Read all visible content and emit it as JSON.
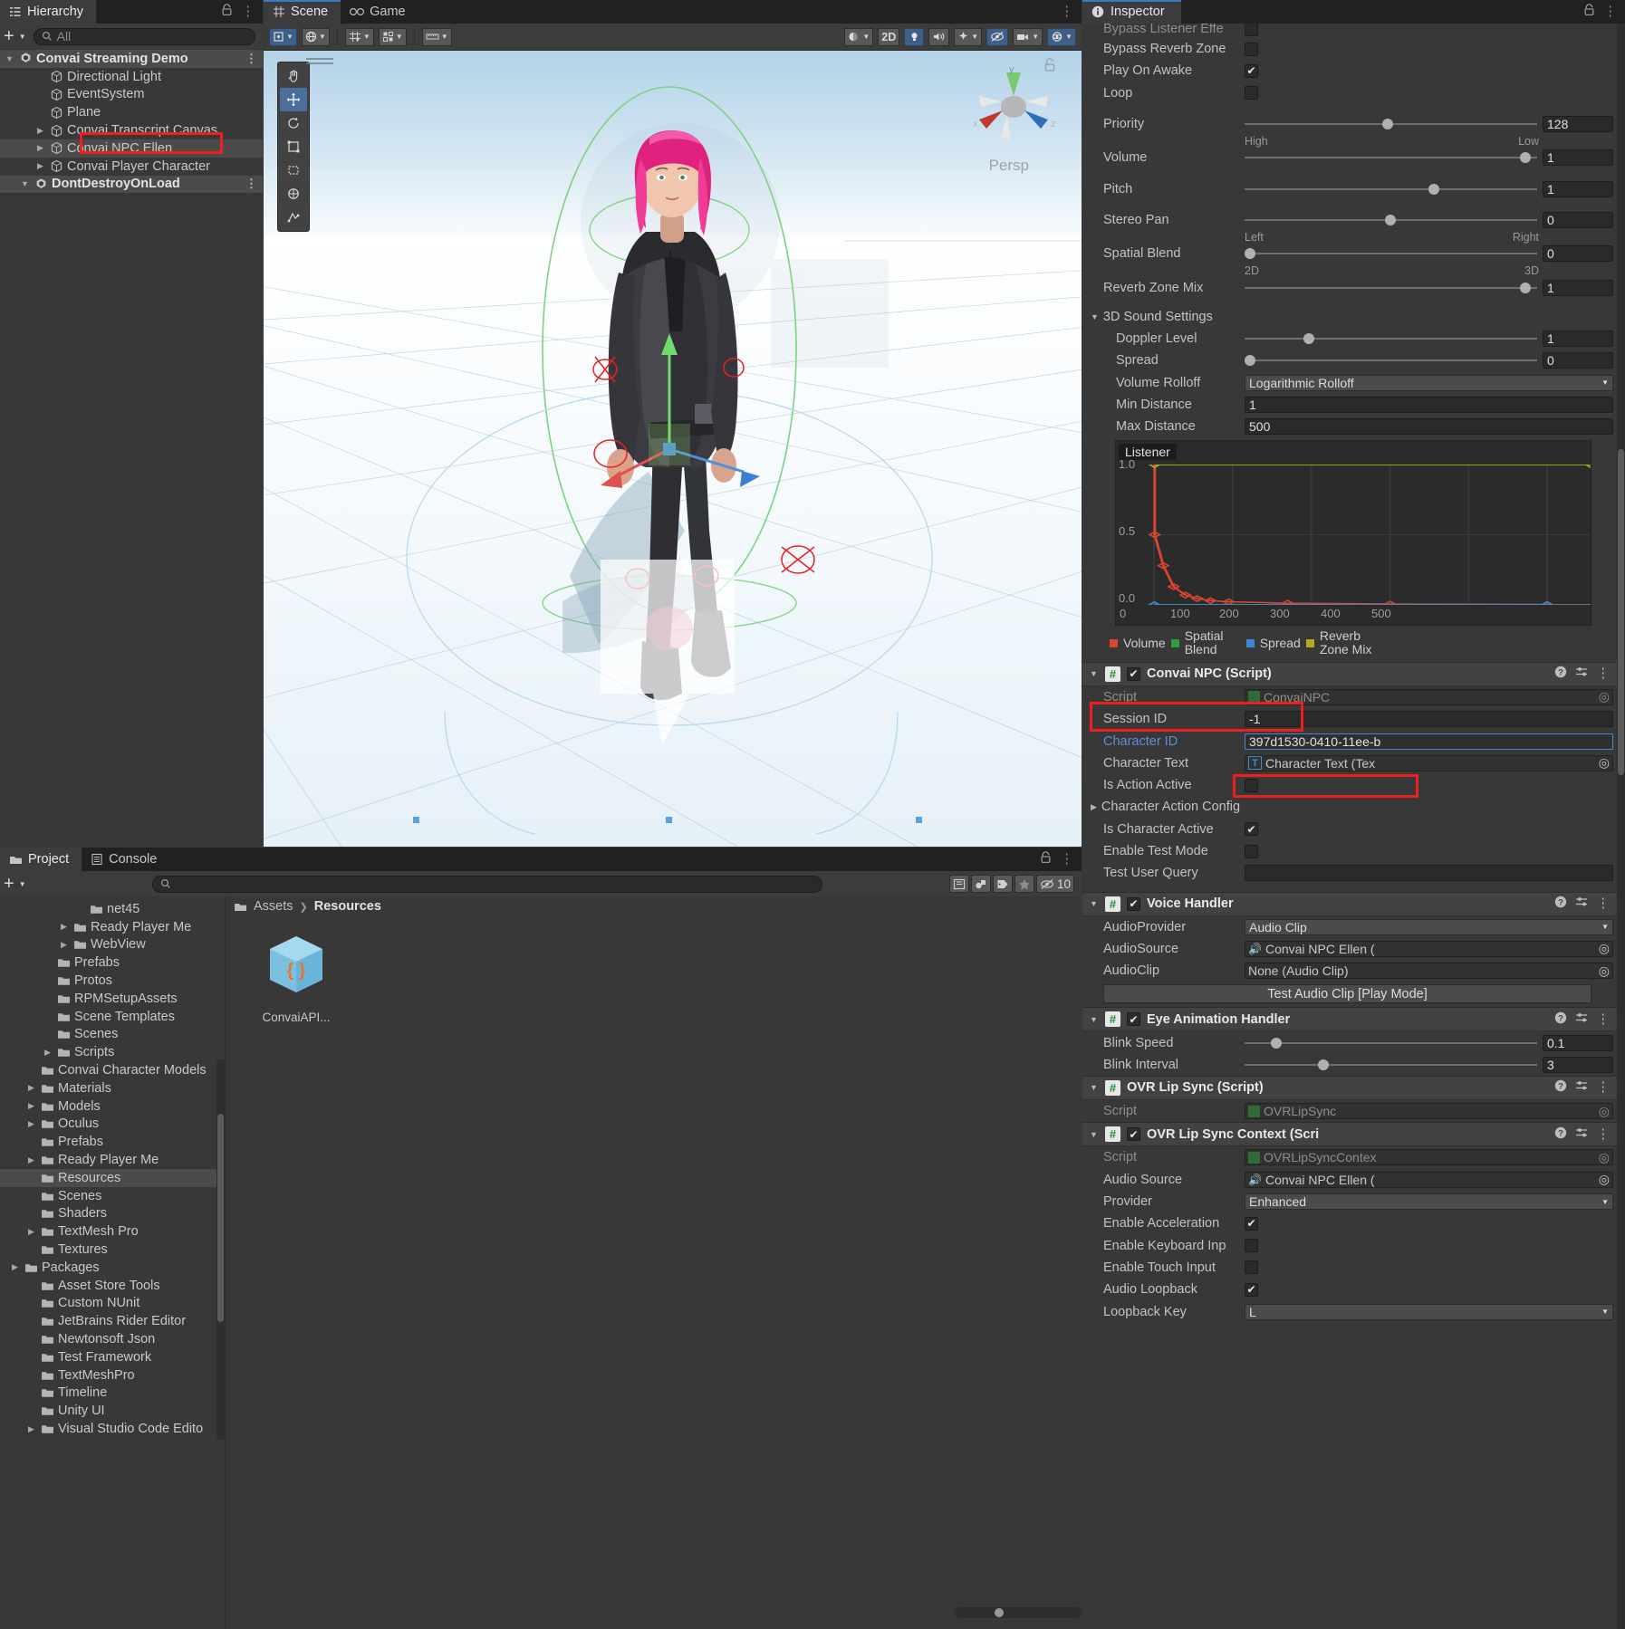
{
  "hierarchy": {
    "tab_label": "Hierarchy",
    "search_placeholder": "All",
    "add_label": "+",
    "items": [
      {
        "label": "Convai Streaming Demo",
        "icon": "unity-scene-icon",
        "kind": "scene",
        "expanded": true,
        "depth": 0
      },
      {
        "label": "Directional Light",
        "icon": "gameobject-cube-icon",
        "kind": "object",
        "expanded": null,
        "depth": 2
      },
      {
        "label": "EventSystem",
        "icon": "gameobject-cube-icon",
        "kind": "object",
        "expanded": null,
        "depth": 2
      },
      {
        "label": "Plane",
        "icon": "gameobject-cube-icon",
        "kind": "object",
        "expanded": null,
        "depth": 2
      },
      {
        "label": "Convai Transcript Canvas",
        "icon": "gameobject-cube-icon",
        "kind": "object",
        "expanded": false,
        "depth": 2
      },
      {
        "label": "Convai NPC Ellen",
        "icon": "gameobject-cube-icon",
        "kind": "object",
        "expanded": false,
        "depth": 2,
        "highlighted": true
      },
      {
        "label": "Convai Player Character",
        "icon": "gameobject-cube-icon",
        "kind": "object",
        "expanded": false,
        "depth": 2
      },
      {
        "label": "DontDestroyOnLoad",
        "icon": "unity-scene-icon",
        "kind": "scene",
        "expanded": true,
        "depth": 1
      }
    ]
  },
  "scene_view": {
    "tabs": [
      {
        "label": "Scene",
        "icon": "scene-grid-icon",
        "active": true
      },
      {
        "label": "Game",
        "icon": "game-pad-icon",
        "active": false
      }
    ],
    "projection_label": "Persp",
    "gizmo_axes": [
      "x",
      "y",
      "z"
    ],
    "toolbar": {
      "pivot_icon": "pivot-center-icon",
      "globe_icon": "global-space-icon",
      "grid_icon": "grid-snap-icon",
      "layers_icon": "component-toggle-icon",
      "audio_icon": "audio-ruler-icon",
      "shading_label": "shaded-mode-icon",
      "mode_2d_label": "2D",
      "light_icon": "light-toggle-icon",
      "audio_toggle_icon": "audio-toggle-icon",
      "fx_icon": "effects-icon",
      "hidden_icon": "hidden-objects-icon",
      "camera_icon": "scene-camera-icon",
      "gizmos_icon": "gizmos-icon"
    },
    "view_tools": [
      {
        "icon": "hand-tool-icon",
        "active": false
      },
      {
        "icon": "move-tool-icon",
        "active": true
      },
      {
        "icon": "rotate-tool-icon",
        "active": false
      },
      {
        "icon": "scale-tool-icon",
        "active": false
      },
      {
        "icon": "rect-tool-icon",
        "active": false
      },
      {
        "icon": "transform-tool-icon",
        "active": false
      },
      {
        "icon": "custom-tool-icon",
        "active": false
      }
    ]
  },
  "project": {
    "tabs": [
      {
        "label": "Project",
        "icon": "folder-icon",
        "active": true
      },
      {
        "label": "Console",
        "icon": "console-icon",
        "active": false
      }
    ],
    "search_placeholder": "",
    "toolbar_icons": [
      "save-search-icon",
      "asset-filter-icon",
      "label-filter-icon",
      "favorite-star-icon",
      "visibility-icon"
    ],
    "hidden_count": "10",
    "breadcrumb": [
      "Assets",
      "Resources"
    ],
    "tree": [
      {
        "label": "net45",
        "depth": 4,
        "expandable": false
      },
      {
        "label": "Ready Player Me",
        "depth": 3,
        "expandable": true
      },
      {
        "label": "WebView",
        "depth": 3,
        "expandable": true
      },
      {
        "label": "Prefabs",
        "depth": 2,
        "expandable": false
      },
      {
        "label": "Protos",
        "depth": 2,
        "expandable": false
      },
      {
        "label": "RPMSetupAssets",
        "depth": 2,
        "expandable": false
      },
      {
        "label": "Scene Templates",
        "depth": 2,
        "expandable": false
      },
      {
        "label": "Scenes",
        "depth": 2,
        "expandable": false
      },
      {
        "label": "Scripts",
        "depth": 2,
        "expandable": true
      },
      {
        "label": "Convai Character Models",
        "depth": 1,
        "expandable": false
      },
      {
        "label": "Materials",
        "depth": 1,
        "expandable": true
      },
      {
        "label": "Models",
        "depth": 1,
        "expandable": true
      },
      {
        "label": "Oculus",
        "depth": 1,
        "expandable": true
      },
      {
        "label": "Prefabs",
        "depth": 1,
        "expandable": false
      },
      {
        "label": "Ready Player Me",
        "depth": 1,
        "expandable": true
      },
      {
        "label": "Resources",
        "depth": 1,
        "expandable": false,
        "selected": true
      },
      {
        "label": "Scenes",
        "depth": 1,
        "expandable": false
      },
      {
        "label": "Shaders",
        "depth": 1,
        "expandable": false
      },
      {
        "label": "TextMesh Pro",
        "depth": 1,
        "expandable": true
      },
      {
        "label": "Textures",
        "depth": 1,
        "expandable": false
      },
      {
        "label": "Packages",
        "depth": 0,
        "expandable": true,
        "isroot": true
      },
      {
        "label": "Asset Store Tools",
        "depth": 1,
        "expandable": false
      },
      {
        "label": "Custom NUnit",
        "depth": 1,
        "expandable": false
      },
      {
        "label": "JetBrains Rider Editor",
        "depth": 1,
        "expandable": false
      },
      {
        "label": "Newtonsoft Json",
        "depth": 1,
        "expandable": false
      },
      {
        "label": "Test Framework",
        "depth": 1,
        "expandable": false
      },
      {
        "label": "TextMeshPro",
        "depth": 1,
        "expandable": false
      },
      {
        "label": "Timeline",
        "depth": 1,
        "expandable": false
      },
      {
        "label": "Unity UI",
        "depth": 1,
        "expandable": false
      },
      {
        "label": "Visual Studio Code Edito",
        "depth": 1,
        "expandable": true
      }
    ],
    "assets": [
      {
        "label": "ConvaiAPI...",
        "icon": "json-asset-icon"
      }
    ]
  },
  "inspector": {
    "tab_label": "Inspector",
    "audio_source": {
      "rows": [
        {
          "label": "Bypass Listener Effe",
          "type": "checkbox",
          "value": false,
          "clipped": true
        },
        {
          "label": "Bypass Reverb Zone",
          "type": "checkbox",
          "value": false
        },
        {
          "label": "Play On Awake",
          "type": "checkbox",
          "value": true
        },
        {
          "label": "Loop",
          "type": "checkbox",
          "value": false
        }
      ],
      "priority": {
        "label": "Priority",
        "value": "128",
        "knob_pct": 47,
        "left_label": "High",
        "right_label": "Low"
      },
      "volume": {
        "label": "Volume",
        "value": "1",
        "knob_pct": 94
      },
      "pitch": {
        "label": "Pitch",
        "value": "1",
        "knob_pct": 63
      },
      "stereo_pan": {
        "label": "Stereo Pan",
        "value": "0",
        "knob_pct": 48,
        "left_label": "Left",
        "right_label": "Right"
      },
      "spatial_blend": {
        "label": "Spatial Blend",
        "value": "0",
        "knob_pct": 2,
        "left_label": "2D",
        "right_label": "3D"
      },
      "reverb_zone_mix": {
        "label": "Reverb Zone Mix",
        "value": "1",
        "knob_pct": 94
      }
    },
    "sound3d": {
      "section_label": "3D Sound Settings",
      "doppler_level": {
        "label": "Doppler Level",
        "value": "1",
        "knob_pct": 20
      },
      "spread": {
        "label": "Spread",
        "value": "0",
        "knob_pct": 1
      },
      "volume_rolloff": {
        "label": "Volume Rolloff",
        "value": "Logarithmic Rolloff"
      },
      "min_distance": {
        "label": "Min Distance",
        "value": "1"
      },
      "max_distance": {
        "label": "Max Distance",
        "value": "500"
      }
    },
    "convai_npc": {
      "title": "Convai NPC (Script)",
      "enabled": true,
      "highlighted": true,
      "rows": [
        {
          "label": "Script",
          "type": "object",
          "value": "ConvaiNPC",
          "disabled": true
        },
        {
          "label": "Session ID",
          "type": "text",
          "value": "-1"
        },
        {
          "label": "Character ID",
          "type": "text",
          "value": "397d1530-0410-11ee-b",
          "focused": true,
          "label_color": "blue",
          "highlighted": true
        },
        {
          "label": "Character Text",
          "type": "object",
          "value": "Character Text (Tex",
          "icon": "tmp-text-icon"
        },
        {
          "label": "Is Action Active",
          "type": "checkbox",
          "value": false
        },
        {
          "label": "Character Action Config",
          "type": "foldout",
          "expanded": false
        },
        {
          "label": "Is Character Active",
          "type": "checkbox",
          "value": true
        },
        {
          "label": "Enable Test Mode",
          "type": "checkbox",
          "value": false
        },
        {
          "label": "Test User Query",
          "type": "text",
          "value": ""
        }
      ]
    },
    "voice_handler": {
      "title": "Voice Handler",
      "enabled": true,
      "rows": [
        {
          "label": "AudioProvider",
          "type": "dropdown",
          "value": "Audio Clip"
        },
        {
          "label": "AudioSource",
          "type": "object",
          "value": "Convai NPC Ellen (",
          "icon": "audio-source-icon"
        },
        {
          "label": "AudioClip",
          "type": "object",
          "value": "None (Audio Clip)"
        }
      ],
      "button_label": "Test Audio Clip [Play Mode]"
    },
    "eye_animation": {
      "title": "Eye Animation Handler",
      "enabled": true,
      "blink_speed": {
        "label": "Blink Speed",
        "value": "0.1",
        "knob_pct": 9
      },
      "blink_interval": {
        "label": "Blink Interval",
        "value": "3",
        "knob_pct": 25
      }
    },
    "ovr_lip_sync": {
      "title": "OVR Lip Sync (Script)",
      "enabled": null,
      "rows": [
        {
          "label": "Script",
          "type": "object",
          "value": "OVRLipSync",
          "disabled": true
        }
      ]
    },
    "ovr_lip_sync_context": {
      "title": "OVR Lip Sync Context (Scri",
      "enabled": true,
      "rows": [
        {
          "label": "Script",
          "type": "object",
          "value": "OVRLipSyncContex",
          "disabled": true
        },
        {
          "label": "Audio Source",
          "type": "object",
          "value": "Convai NPC Ellen (",
          "icon": "audio-source-icon"
        },
        {
          "label": "Provider",
          "type": "dropdown",
          "value": "Enhanced"
        },
        {
          "label": "Enable Acceleration",
          "type": "checkbox",
          "value": true
        },
        {
          "label": "Enable Keyboard Inp",
          "type": "checkbox",
          "value": false
        },
        {
          "label": "Enable Touch Input",
          "type": "checkbox",
          "value": false
        },
        {
          "label": "Audio Loopback",
          "type": "checkbox",
          "value": true
        },
        {
          "label": "Loopback Key",
          "type": "dropdown",
          "value": "L"
        }
      ]
    }
  },
  "chart_data": {
    "type": "line",
    "title": "Listener",
    "xlabel": "",
    "ylabel": "",
    "xlim": [
      0,
      555
    ],
    "ylim": [
      0,
      1.0
    ],
    "xticks": [
      "0",
      "100",
      "200",
      "300",
      "400",
      "500"
    ],
    "yticks": [
      "0.0",
      "0.5",
      "1.0"
    ],
    "grid": true,
    "legend_position": "bottom",
    "series": [
      {
        "name": "Volume",
        "color": "#d9452f",
        "x": [
          1,
          1,
          12,
          25,
          40,
          55,
          72,
          95,
          170,
          300,
          500
        ],
        "y": [
          1.0,
          0.5,
          0.28,
          0.13,
          0.07,
          0.045,
          0.03,
          0.022,
          0.012,
          0.006,
          0.003
        ]
      },
      {
        "name": "Spatial Blend",
        "color": "#2f9e3f",
        "x": [
          0,
          500
        ],
        "y": [
          0,
          0
        ]
      },
      {
        "name": "Spread",
        "color": "#3d86d9",
        "x": [
          1,
          500
        ],
        "y": [
          0,
          0
        ]
      },
      {
        "name": "Reverb Zone Mix",
        "color": "#b0ad1f",
        "x": [
          1,
          555
        ],
        "y": [
          1.0,
          1.0
        ]
      }
    ]
  },
  "colors": {
    "accent_blue": "#3a79c8",
    "annotation_red": "#f01f1f",
    "panel_bg": "#383838",
    "header_bg": "#424242",
    "field_bg": "#2a2a2a",
    "script_green": "#1f8a3c"
  }
}
